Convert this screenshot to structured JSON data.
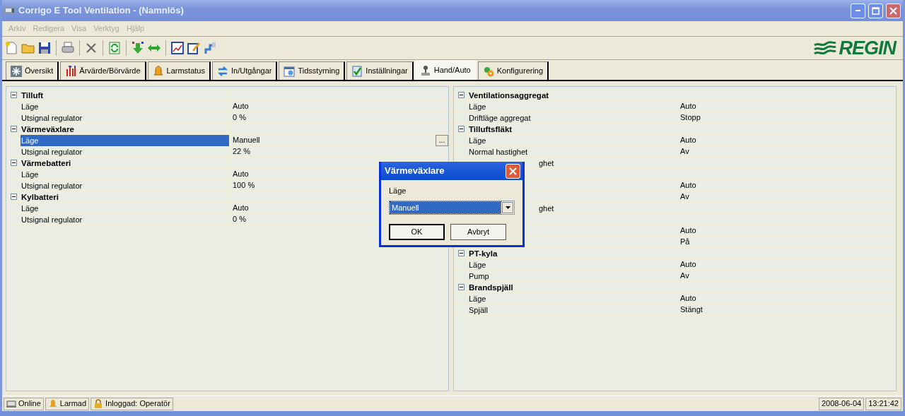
{
  "window": {
    "title": "Corrigo E Tool Ventilation - (Namnlös)"
  },
  "menu": [
    {
      "label": "Arkiv",
      "disabled": true
    },
    {
      "label": "Redigera",
      "disabled": true
    },
    {
      "label": "Visa",
      "disabled": true
    },
    {
      "label": "Verktyg",
      "disabled": true
    },
    {
      "label": "Hjälp",
      "disabled": true
    }
  ],
  "logo": {
    "text": "REGIN"
  },
  "tabs": [
    {
      "label": "Översikt",
      "selected": false
    },
    {
      "label": "Ärvärde/Börvärde",
      "selected": false
    },
    {
      "label": "Larmstatus",
      "selected": false
    },
    {
      "label": "In/Utgångar",
      "selected": false
    },
    {
      "label": "Tidsstyrning",
      "selected": false
    },
    {
      "label": "Inställningar",
      "selected": false
    },
    {
      "label": "Hand/Auto",
      "selected": true
    },
    {
      "label": "Konfigurering",
      "selected": false
    }
  ],
  "panels": [
    {
      "groups": [
        {
          "title": "Tilluft",
          "expanded": true,
          "children": [
            {
              "label": "Läge",
              "value": "Auto",
              "selected": false
            },
            {
              "label": "Utsignal regulator",
              "value": "0 %",
              "selected": false
            }
          ]
        },
        {
          "title": "Värmeväxlare",
          "expanded": true,
          "children": [
            {
              "label": "Läge",
              "value": "Manuell",
              "selected": true,
              "button": "..."
            },
            {
              "label": "Utsignal regulator",
              "value": "22 %",
              "selected": false
            }
          ]
        },
        {
          "title": "Värmebatteri",
          "expanded": true,
          "children": [
            {
              "label": "Läge",
              "value": "Auto",
              "selected": false
            },
            {
              "label": "Utsignal regulator",
              "value": "100 %",
              "selected": false
            }
          ]
        },
        {
          "title": "Kylbatteri",
          "expanded": true,
          "children": [
            {
              "label": "Läge",
              "value": "Auto",
              "selected": false
            },
            {
              "label": "Utsignal regulator",
              "value": "0 %",
              "selected": false
            }
          ]
        }
      ]
    },
    {
      "groups": [
        {
          "title": "Ventilationsaggregat",
          "expanded": true,
          "children": [
            {
              "label": "Läge",
              "value": "Auto",
              "selected": false
            },
            {
              "label": "Driftläge aggregat",
              "value": "Stopp",
              "selected": false
            }
          ]
        },
        {
          "title": "Tilluftsfläkt",
          "expanded": true,
          "children": [
            {
              "label": "Läge",
              "value": "Auto",
              "selected": false
            },
            {
              "label": "Normal hastighet",
              "value": "Av",
              "selected": false
            },
            {
              "label": "ghet",
              "kind": "partial",
              "selected": false
            }
          ]
        },
        {
          "children": [
            {
              "value": "Auto",
              "selected": false
            },
            {
              "value": "Av",
              "selected": false
            },
            {
              "label": "ghet",
              "kind": "partial",
              "selected": false
            }
          ]
        },
        {
          "children": [
            {
              "value": "Auto",
              "selected": false
            },
            {
              "value": "På",
              "selected": false
            }
          ]
        },
        {
          "title": "PT-kyla",
          "expanded": true,
          "children": [
            {
              "label": "Läge",
              "value": "Auto",
              "selected": false
            },
            {
              "label": "Pump",
              "value": "Av",
              "selected": false
            }
          ]
        },
        {
          "title": "Brandspjäll",
          "expanded": true,
          "children": [
            {
              "label": "Läge",
              "value": "Auto",
              "selected": false
            },
            {
              "label": "Spjäll",
              "value": "Stängt",
              "selected": false
            }
          ]
        }
      ]
    }
  ],
  "dialog": {
    "title": "Värmeväxlare",
    "field_label": "Läge",
    "select_value": "Manuell",
    "buttons": [
      "OK",
      "Avbryt"
    ]
  },
  "status_bar": {
    "left": [
      "Online",
      "Larmad",
      "Inloggad: Operatör"
    ],
    "right": [
      "2008-06-04",
      "13:21:42"
    ]
  }
}
